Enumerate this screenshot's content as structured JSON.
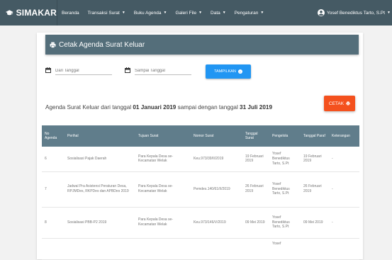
{
  "navbar": {
    "brand": "SIMAKAR",
    "items": [
      {
        "label": "Beranda",
        "dropdown": false
      },
      {
        "label": "Transaksi Surat",
        "dropdown": true
      },
      {
        "label": "Buku Agenda",
        "dropdown": true
      },
      {
        "label": "Galeri File",
        "dropdown": true
      },
      {
        "label": "Data",
        "dropdown": true
      },
      {
        "label": "Pengaturan",
        "dropdown": true
      }
    ],
    "user": "Yosef Benediktus Tarto, S.Pt"
  },
  "card": {
    "title": "Cetak Agenda Surat Keluar",
    "from_placeholder": "Dari Tanggal",
    "to_placeholder": "Sampai Tanggal",
    "show_button": "TAMPILKAN",
    "heading_prefix": "Agenda Surat Keluar dari tanggal ",
    "date_from": "01 Januari 2019",
    "heading_mid": " sampai dengan tanggal ",
    "date_to": "31 Juli 2019",
    "print_button": "CETAK"
  },
  "table": {
    "headers": [
      "No Agenda",
      "Perihal",
      "Tujuan Surat",
      "Nomor Surat",
      "Tanggal Surat",
      "Pengelola",
      "Tanggal Paraf",
      "Keterangan"
    ],
    "rows": [
      [
        "6",
        "Sosialisasi Pajak Daerah",
        "Para Kepala Desa se-Kecamatan Welak",
        "Keu.973/39/II/2019",
        "19 Februari 2019",
        "Yosef Benediktus Tarto, S.Pt",
        "19 Februari 2019",
        "-"
      ],
      [
        "7",
        "Jadwal Pra Asistensi Peraturan Desa, RPJMDes, RKPDes dan APBDes 2019",
        "Para Kepala Desa se-Kecamatan Welak",
        "Pemdes.140/61/II/2019",
        "26 Februari 2019",
        "Yosef Benediktus Tarto, S.Pt",
        "26 Februari 2019",
        "-"
      ],
      [
        "8",
        "Sosialisasi PBB-P2 2019",
        "Para Kepala Desa se-Kecamatan Welak",
        "Keu.973/146/V/2019",
        "09 Mei 2019",
        "Yosef Benediktus Tarto, S.Pt",
        "09 Mei 2019",
        "-"
      ],
      [
        "",
        "",
        "",
        "",
        "",
        "Yosef",
        "",
        ""
      ]
    ]
  },
  "colors": {
    "navbar": "#455a64",
    "card_header": "#546e7a",
    "table_header": "#607d8b",
    "show_button": "#2196f3",
    "print_button": "#f4511e"
  }
}
